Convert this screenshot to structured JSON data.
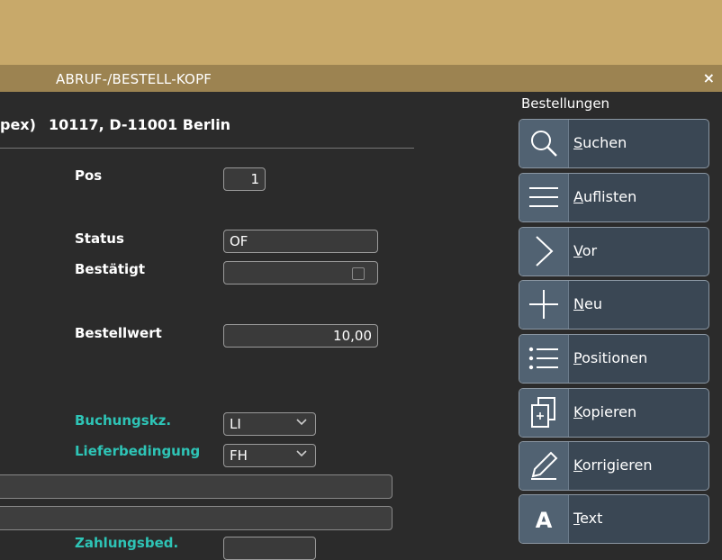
{
  "window": {
    "title": "ABRUF-/BESTELL-KOPF",
    "close_label": "×"
  },
  "header": {
    "address_prefix": "pex)",
    "address": "10117, D-11001 Berlin"
  },
  "form": {
    "pos_label": "Pos",
    "pos_value": "1",
    "status_label": "Status",
    "status_value": "OF",
    "bestaetigt_label": "Bestätigt",
    "bestaetigt_value": "",
    "bestellwert_label": "Bestellwert",
    "bestellwert_value": "10,00",
    "buchungskz_label": "Buchungskz.",
    "buchungskz_value": "LI",
    "lieferbedingung_label": "Lieferbedingung",
    "lieferbedingung_value": "FH",
    "zahlungsbed_label": "Zahlungsbed."
  },
  "sidebar": {
    "title": "Bestellungen",
    "buttons": [
      {
        "hotkey": "S",
        "rest": "uchen",
        "icon": "search-icon"
      },
      {
        "hotkey": "A",
        "rest": "uflisten",
        "icon": "list-lines-icon"
      },
      {
        "hotkey": "V",
        "rest": "or",
        "icon": "chevron-right-icon"
      },
      {
        "hotkey": "N",
        "rest": "eu",
        "icon": "plus-icon"
      },
      {
        "hotkey": "P",
        "rest": "ositionen",
        "icon": "bullet-list-icon"
      },
      {
        "hotkey": "K",
        "rest": "opieren",
        "icon": "copy-icon"
      },
      {
        "hotkey": "K",
        "rest": "orrigieren",
        "icon": "pencil-icon"
      },
      {
        "hotkey": "T",
        "rest": "ext",
        "icon": "text-icon"
      }
    ]
  },
  "colors": {
    "top_bar": "#c8a96a",
    "title_bar": "#9c8351",
    "background": "#2b2b2b",
    "accent_label": "#2ec4b6",
    "button_bg": "#3a4754",
    "button_icon_bg": "#516272"
  }
}
